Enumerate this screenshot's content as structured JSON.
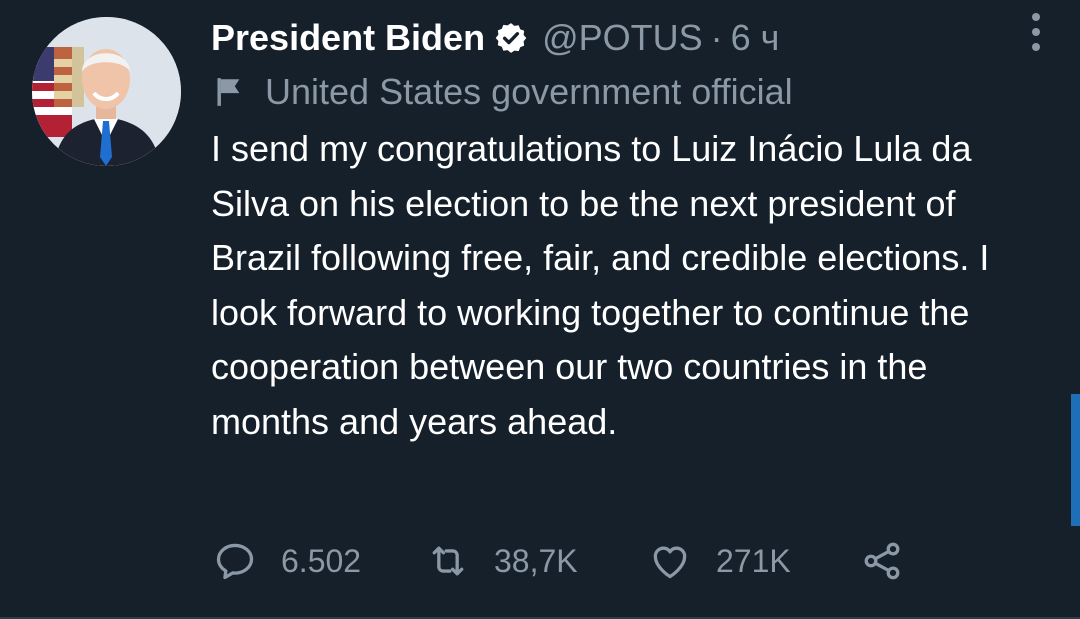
{
  "tweet": {
    "author_name": "President Biden",
    "handle": "@POTUS",
    "separator": "·",
    "time": "6 ч",
    "label": "United States government official",
    "text": "I send my congratulations to Luiz Inácio Lula da Silva on his election to be the next president of Brazil following free, fair, and credible elections. I look forward to working together to continue the cooperation between our two countries in the months and years ahead.",
    "stats": {
      "replies": "6.502",
      "retweets": "38,7K",
      "likes": "271K"
    }
  },
  "icons": {
    "verified": "verified-badge-icon",
    "more": "more-vertical-icon",
    "flag": "flag-icon",
    "reply": "reply-icon",
    "retweet": "retweet-icon",
    "like": "heart-icon",
    "share": "share-icon"
  },
  "colors": {
    "background": "#15202b",
    "text_primary": "#ffffff",
    "text_secondary": "#8b98a5",
    "scroll_accent": "#1d6fb8"
  }
}
